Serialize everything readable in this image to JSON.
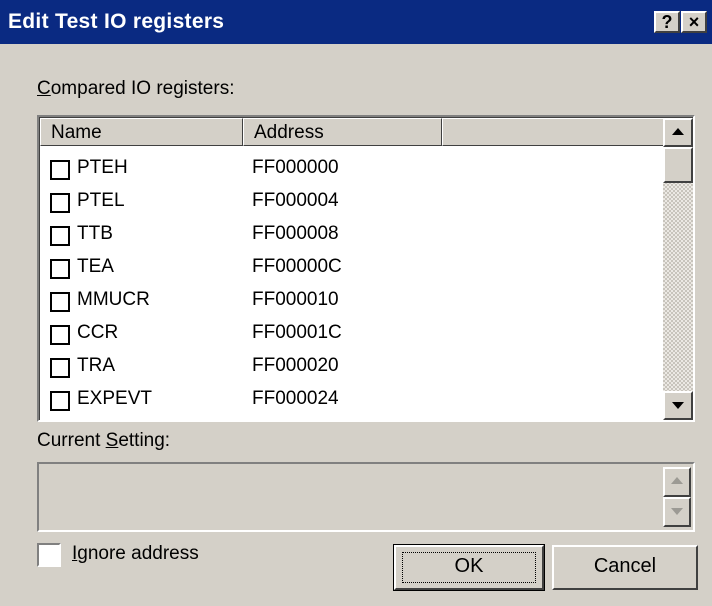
{
  "window": {
    "title": "Edit Test IO registers",
    "help_button": "?",
    "close_button": "×"
  },
  "compared": {
    "label_accel": "C",
    "label_rest": "ompared IO registers:",
    "columns": [
      "Name",
      "Address",
      ""
    ],
    "rows": [
      {
        "name": "PTEH",
        "address": "FF000000"
      },
      {
        "name": "PTEL",
        "address": "FF000004"
      },
      {
        "name": "TTB",
        "address": "FF000008"
      },
      {
        "name": "TEA",
        "address": "FF00000C"
      },
      {
        "name": "MMUCR",
        "address": "FF000010"
      },
      {
        "name": "CCR",
        "address": "FF00001C"
      },
      {
        "name": "TRA",
        "address": "FF000020"
      },
      {
        "name": "EXPEVT",
        "address": "FF000024"
      }
    ]
  },
  "current_setting": {
    "label_pre": "Current ",
    "label_accel": "S",
    "label_rest": "etting:",
    "value": ""
  },
  "ignore_address": {
    "label_accel": "I",
    "label_rest": "gnore address",
    "checked": false
  },
  "buttons": {
    "ok": "OK",
    "cancel": "Cancel"
  },
  "colors": {
    "titlebar": "#0a2a82",
    "face": "#d4d0c8"
  }
}
